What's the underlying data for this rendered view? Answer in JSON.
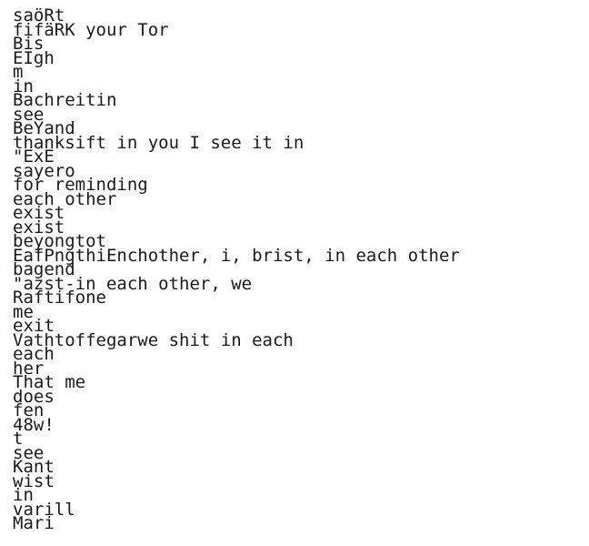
{
  "document": {
    "lines": [
      "saöRt",
      "fifäRK your Tor",
      "Bis",
      "EIgh",
      "m",
      "in",
      "Bachreitin",
      "see",
      "BeYand",
      "thanksift in you I see it in",
      "\"ExE",
      "sayero",
      "for reminding",
      "each other",
      "exist",
      "exist",
      "beyongtot",
      "EafPngthiEnchother, i, brist, in each other",
      "bagend",
      "\"azst-in each other, we",
      "Raftifone",
      "me",
      "exit",
      "Vathtoffegarwe shit in each",
      "each",
      "her",
      "That me",
      "does",
      "fen",
      "48w!",
      "t",
      "see",
      "Kant",
      "wist",
      "in",
      "varill",
      "Mari"
    ]
  }
}
